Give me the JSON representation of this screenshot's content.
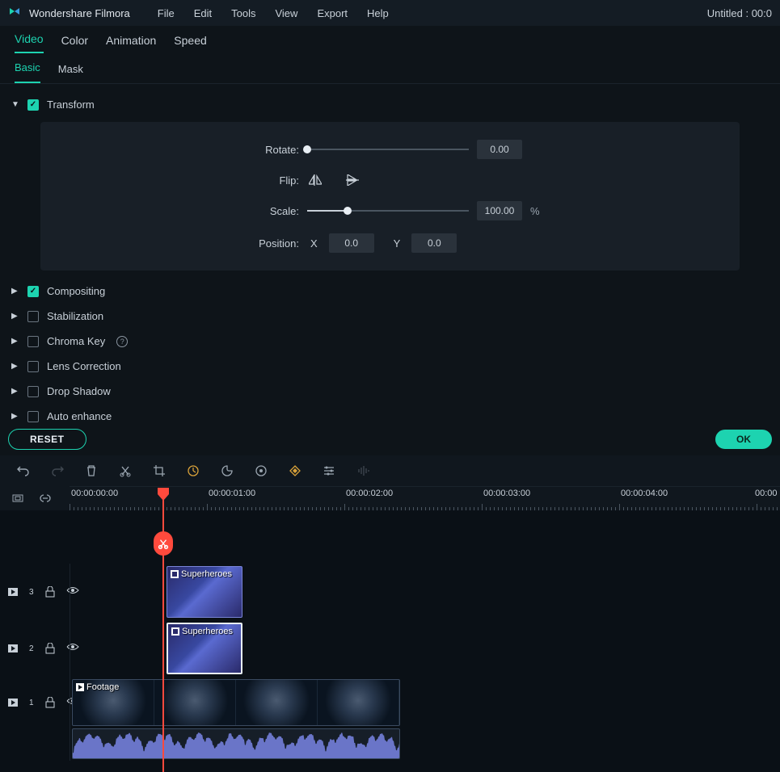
{
  "app_title": "Wondershare Filmora",
  "menu": [
    "File",
    "Edit",
    "Tools",
    "View",
    "Export",
    "Help"
  ],
  "doc_title": "Untitled : 00:0",
  "tabs_primary": [
    "Video",
    "Color",
    "Animation",
    "Speed"
  ],
  "tabs_secondary": [
    "Basic",
    "Mask"
  ],
  "sections": {
    "transform": {
      "label": "Transform",
      "checked": true,
      "expanded": true
    },
    "compositing": {
      "label": "Compositing",
      "checked": true,
      "expanded": false
    },
    "stabilization": {
      "label": "Stabilization",
      "checked": false,
      "expanded": false
    },
    "chroma": {
      "label": "Chroma Key",
      "checked": false,
      "expanded": false
    },
    "lens": {
      "label": "Lens Correction",
      "checked": false,
      "expanded": false
    },
    "drop_shadow": {
      "label": "Drop Shadow",
      "checked": false,
      "expanded": false
    },
    "auto_enhance": {
      "label": "Auto enhance",
      "checked": false,
      "expanded": false
    }
  },
  "transform": {
    "rotate_label": "Rotate:",
    "rotate_value": "0.00",
    "flip_label": "Flip:",
    "scale_label": "Scale:",
    "scale_value": "100.00",
    "scale_unit": "%",
    "position_label": "Position:",
    "pos_x_label": "X",
    "pos_x_value": "0.0",
    "pos_y_label": "Y",
    "pos_y_value": "0.0"
  },
  "buttons": {
    "reset": "RESET",
    "ok": "OK"
  },
  "ruler": {
    "labels": [
      "00:00:00:00",
      "00:00:01:00",
      "00:00:02:00",
      "00:00:03:00",
      "00:00:04:00",
      "00:00"
    ]
  },
  "tracks": {
    "t3": {
      "num": "3"
    },
    "t2": {
      "num": "2"
    },
    "t1": {
      "num": "1"
    }
  },
  "clips": {
    "sh1": "Superheroes",
    "sh2": "Superheroes",
    "footage": "Footage"
  }
}
